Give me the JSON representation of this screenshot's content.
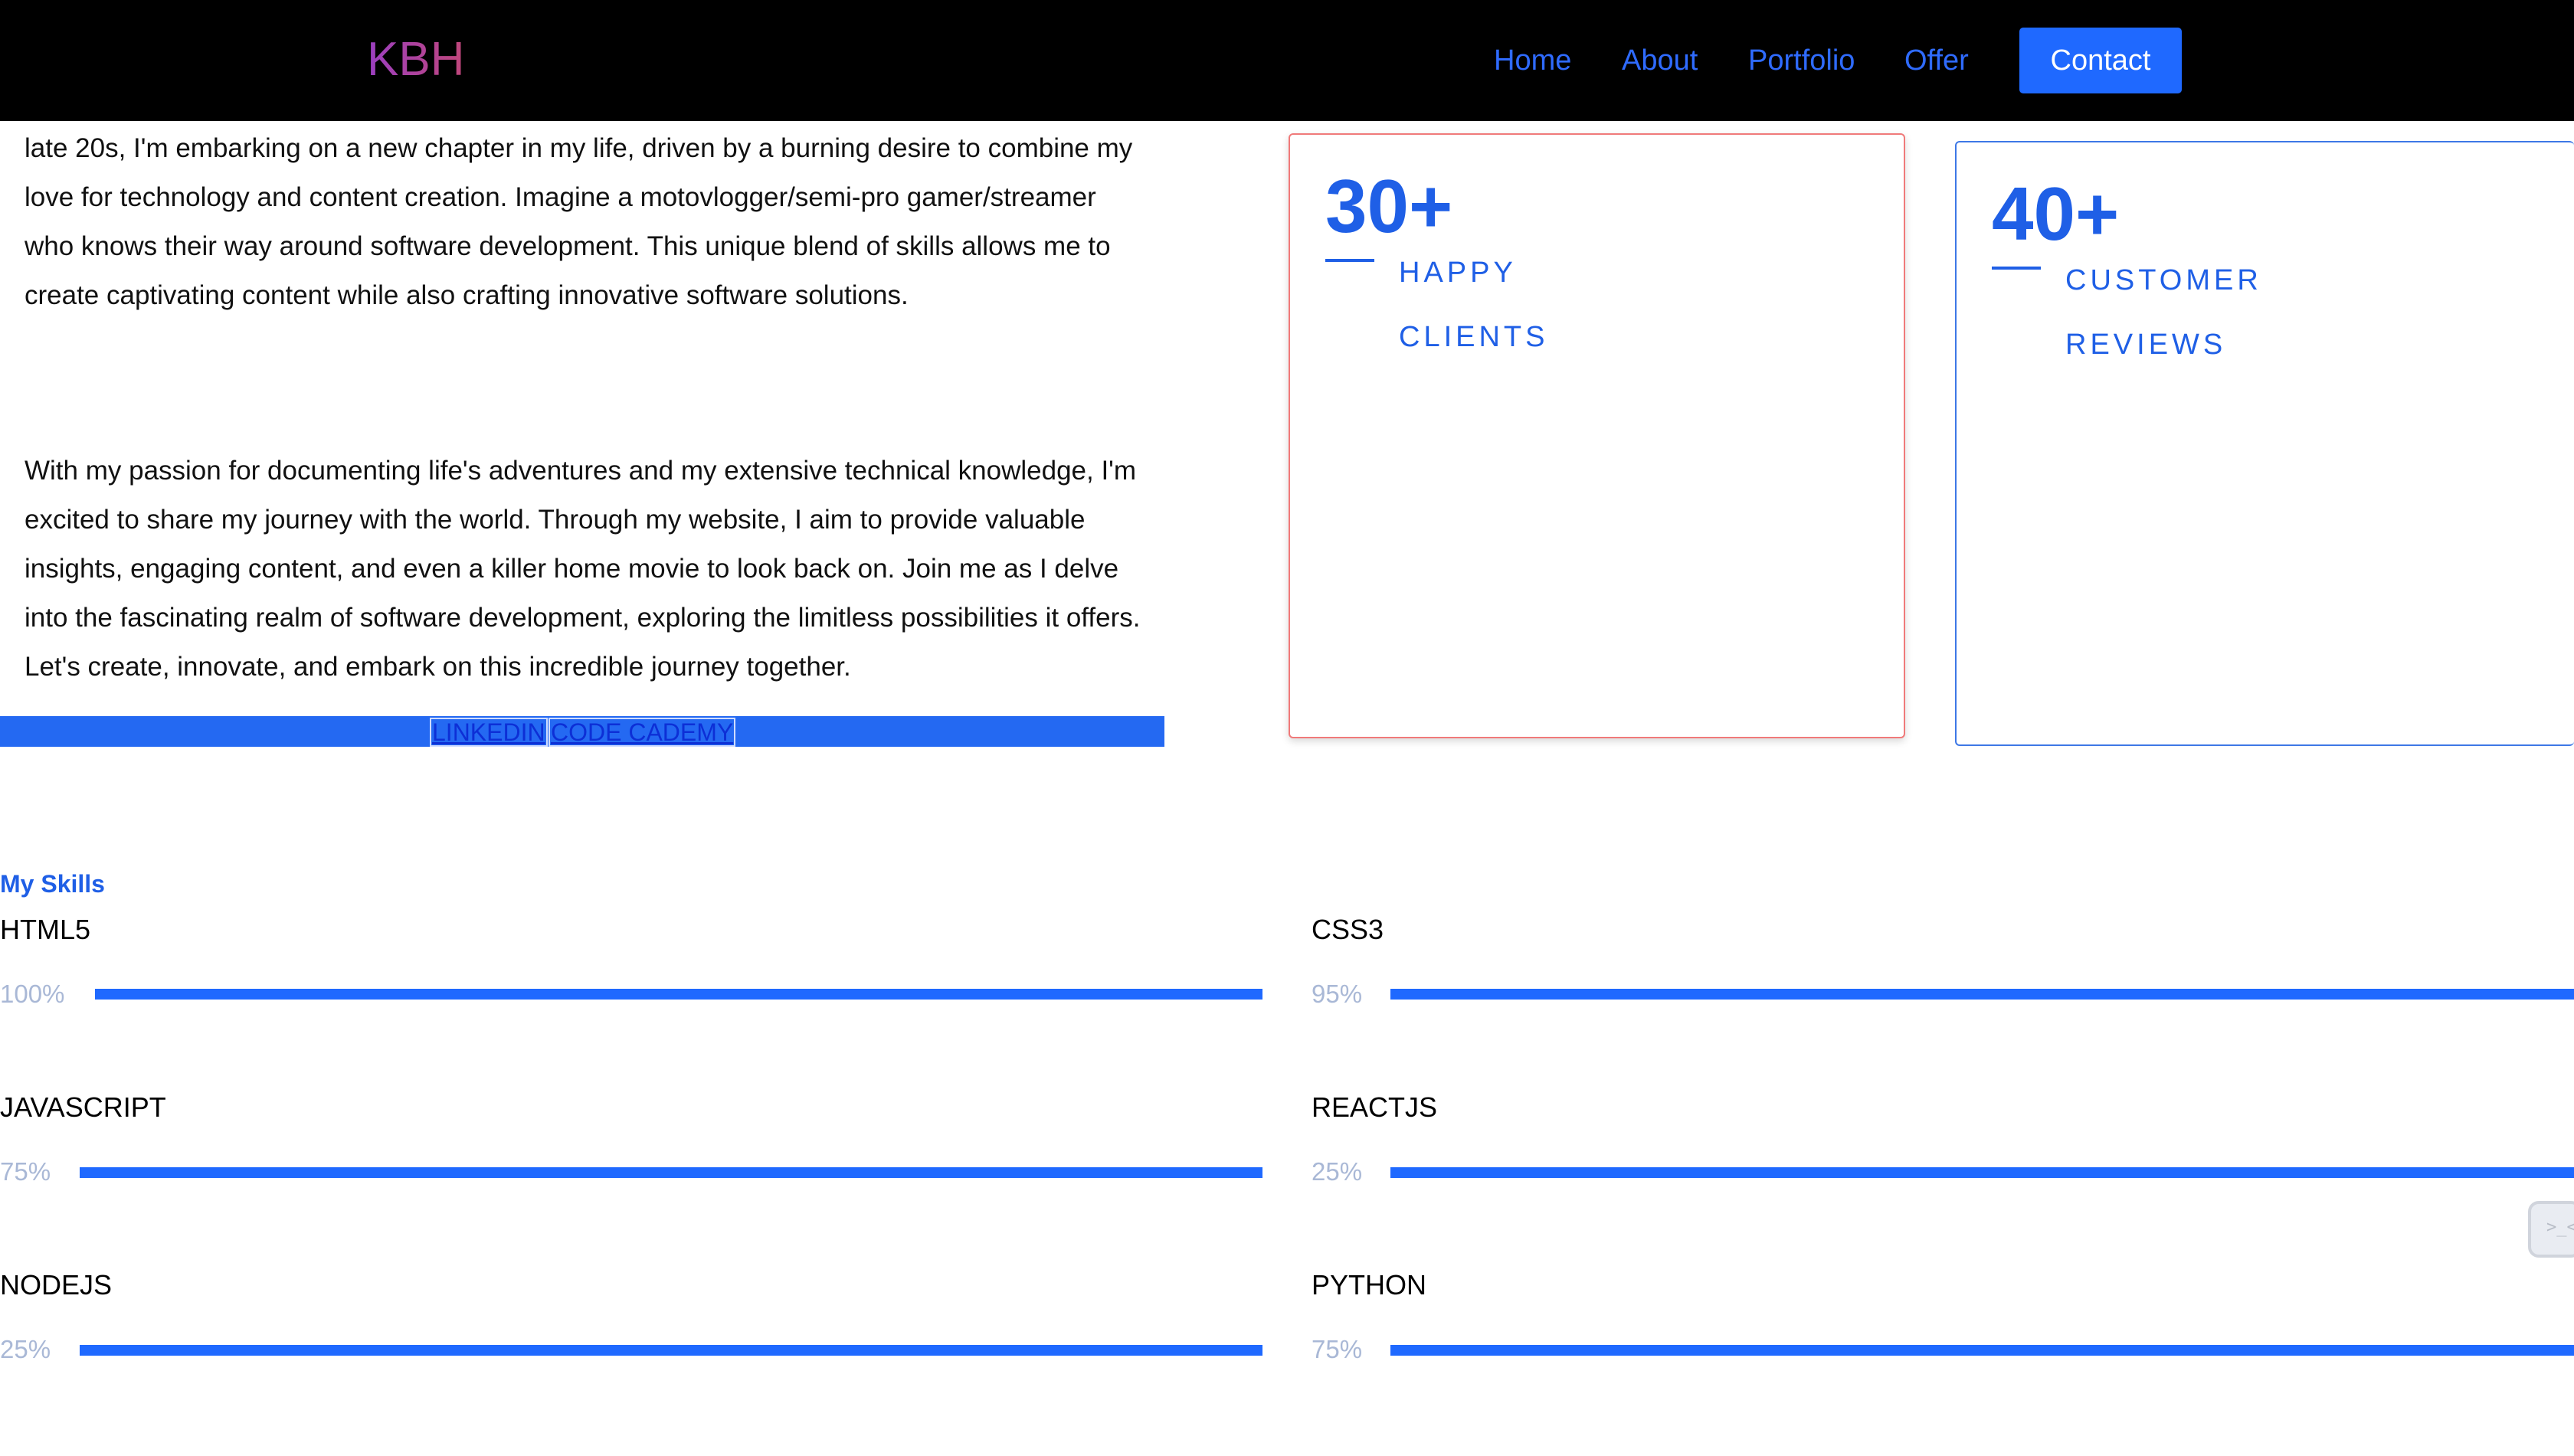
{
  "header": {
    "logo": "KBH",
    "nav": [
      {
        "label": "Home"
      },
      {
        "label": "About"
      },
      {
        "label": "Portfolio"
      },
      {
        "label": "Offer"
      }
    ],
    "contact_label": "Contact"
  },
  "bio": {
    "paragraph1": "late 20s, I'm embarking on a new chapter in my life, driven by a burning desire to combine my love for technology and content creation. Imagine a motovlogger/semi-pro gamer/streamer who knows their way around software development. This unique blend of skills allows me to create captivating content while also crafting innovative software solutions.",
    "paragraph2": "With my passion for documenting life's adventures and my extensive technical knowledge, I'm excited to share my journey with the world. Through my website, I aim to provide valuable insights, engaging content, and even a killer home movie to look back on. Join me as I delve into the fascinating realm of software development, exploring the limitless possibilities it offers. Let's create, innovate, and embark on this incredible journey together."
  },
  "links": {
    "linkedin": "LINKEDIN",
    "codecademy": "CODE CADEMY"
  },
  "stats": [
    {
      "number": "30+",
      "label_line1": "HAPPY",
      "label_line2": "CLIENTS"
    },
    {
      "number": "40+",
      "label_line1": "CUSTOMER",
      "label_line2": "REVIEWS"
    }
  ],
  "skills": {
    "title": "My Skills",
    "items": [
      {
        "name": "HTML5",
        "percent_label": "100%",
        "value": 100
      },
      {
        "name": "CSS3",
        "percent_label": "95%",
        "value": 95
      },
      {
        "name": "JAVASCRIPT",
        "percent_label": "75%",
        "value": 75
      },
      {
        "name": "REACTJS",
        "percent_label": "25%",
        "value": 25
      },
      {
        "name": "NODEJS",
        "percent_label": "25%",
        "value": 25
      },
      {
        "name": "PYTHON",
        "percent_label": "75%",
        "value": 75
      }
    ]
  },
  "widget": {
    "icon": "terminal-icon",
    "glyph": ">_<"
  },
  "colors": {
    "accent": "#1f69ff",
    "header_bg": "#000000",
    "nav_link": "#2f6bff"
  }
}
